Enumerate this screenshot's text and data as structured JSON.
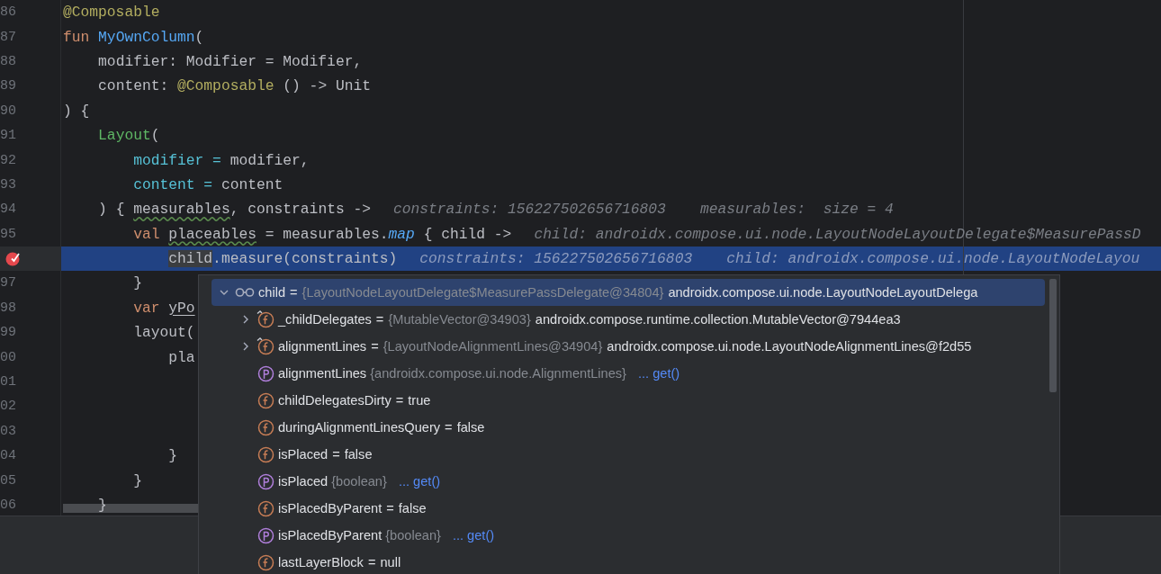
{
  "editor": {
    "lines": [
      {
        "number": "86",
        "current": false,
        "breakpoint": false,
        "tokens": [
          {
            "text": "@Composable",
            "kind": "annotation"
          }
        ]
      },
      {
        "number": "87",
        "current": false,
        "breakpoint": false,
        "tokens": [
          {
            "text": "fun ",
            "kind": "keyword"
          },
          {
            "text": "MyOwnColumn",
            "kind": "function"
          },
          {
            "text": "(",
            "kind": "plain"
          }
        ]
      },
      {
        "number": "88",
        "current": false,
        "breakpoint": false,
        "tokens": [
          {
            "text": "    modifier: Modifier = Modifier,",
            "kind": "plain"
          }
        ]
      },
      {
        "number": "89",
        "current": false,
        "breakpoint": false,
        "tokens": [
          {
            "text": "    content: ",
            "kind": "plain"
          },
          {
            "text": "@Composable",
            "kind": "annotation"
          },
          {
            "text": " () -> Unit",
            "kind": "plain"
          }
        ]
      },
      {
        "number": "90",
        "current": false,
        "breakpoint": false,
        "tokens": [
          {
            "text": ") {",
            "kind": "plain"
          }
        ]
      },
      {
        "number": "91",
        "current": false,
        "breakpoint": false,
        "tokens": [
          {
            "text": "    Layout",
            "kind": "call"
          },
          {
            "text": "(",
            "kind": "plain"
          }
        ]
      },
      {
        "number": "92",
        "current": false,
        "breakpoint": false,
        "tokens": [
          {
            "text": "        modifier =",
            "kind": "named-arg"
          },
          {
            "text": " modifier,",
            "kind": "plain"
          }
        ]
      },
      {
        "number": "93",
        "current": false,
        "breakpoint": false,
        "tokens": [
          {
            "text": "        content =",
            "kind": "named-arg"
          },
          {
            "text": " content",
            "kind": "plain"
          }
        ]
      },
      {
        "number": "94",
        "current": false,
        "breakpoint": false,
        "tokens": [
          {
            "text": "    ) { ",
            "kind": "plain"
          },
          {
            "text": "measurables",
            "kind": "warned"
          },
          {
            "text": ", constraints ->",
            "kind": "plain"
          }
        ],
        "hints": [
          "constraints: 156227502656716803",
          "measurables:  size = 4"
        ]
      },
      {
        "number": "95",
        "current": false,
        "breakpoint": false,
        "tokens": [
          {
            "text": "        val ",
            "kind": "keyword"
          },
          {
            "text": "placeables",
            "kind": "warned"
          },
          {
            "text": " = measurables.",
            "kind": "plain"
          },
          {
            "text": "map",
            "kind": "extension"
          },
          {
            "text": " { child ->",
            "kind": "plain"
          }
        ],
        "hints": [
          "child: androidx.compose.ui.node.LayoutNodeLayoutDelegate$MeasurePassD"
        ]
      },
      {
        "current": true,
        "breakpoint": true,
        "tokens": [
          {
            "text": "            child",
            "kind": "highlighted"
          },
          {
            "text": ".measure(constraints)",
            "kind": "plain"
          }
        ],
        "hints": [
          "constraints: 156227502656716803",
          "child: androidx.compose.ui.node.LayoutNodeLayou"
        ]
      },
      {
        "number": "97",
        "current": false,
        "breakpoint": false,
        "tokens": [
          {
            "text": "        }",
            "kind": "plain"
          }
        ]
      },
      {
        "number": "98",
        "current": false,
        "breakpoint": false,
        "tokens": [
          {
            "text": "        var ",
            "kind": "keyword"
          },
          {
            "text": "yPo",
            "kind": "mutable"
          }
        ]
      },
      {
        "number": "99",
        "current": false,
        "breakpoint": false,
        "tokens": [
          {
            "text": "        layout(",
            "kind": "plain"
          }
        ]
      },
      {
        "number": "00",
        "current": false,
        "breakpoint": false,
        "tokens": [
          {
            "text": "            pla",
            "kind": "plain"
          }
        ]
      },
      {
        "number": "01",
        "current": false,
        "breakpoint": false
      },
      {
        "number": "02",
        "current": false,
        "breakpoint": false
      },
      {
        "number": "03",
        "current": false,
        "breakpoint": false
      },
      {
        "number": "04",
        "current": false,
        "breakpoint": false,
        "tokens": [
          {
            "text": "            }",
            "kind": "plain"
          }
        ]
      },
      {
        "number": "05",
        "current": false,
        "breakpoint": false,
        "tokens": [
          {
            "text": "        }",
            "kind": "plain"
          }
        ]
      },
      {
        "number": "06",
        "current": false,
        "breakpoint": false,
        "tokens": [
          {
            "text": "    }",
            "kind": "plain"
          }
        ]
      }
    ]
  },
  "debug_popup": {
    "tree": [
      {
        "kind": "watch",
        "name": "child",
        "operator": "=",
        "type": "{LayoutNodeLayoutDelegate$MeasurePassDelegate@34804}",
        "value": "androidx.compose.ui.node.LayoutNodeLayoutDelega",
        "selected": true,
        "expanded": true,
        "children": [
          {
            "kind": "field",
            "linked": true,
            "name": "_childDelegates",
            "operator": "=",
            "type": "{MutableVector@34903}",
            "value": "androidx.compose.runtime.collection.MutableVector@7944ea3",
            "selected": false,
            "expanded": false
          },
          {
            "kind": "field",
            "linked": true,
            "name": "alignmentLines",
            "operator": "=",
            "type": "{LayoutNodeAlignmentLines@34904}",
            "value": "androidx.compose.ui.node.LayoutNodeAlignmentLines@f2d55",
            "selected": false,
            "expanded": false
          },
          {
            "kind": "property",
            "linked": false,
            "name": "alignmentLines",
            "type": "{androidx.compose.ui.node.AlignmentLines}",
            "action": "... get()",
            "selected": false
          },
          {
            "kind": "field",
            "linked": false,
            "name": "childDelegatesDirty",
            "operator": "=",
            "value": "true",
            "selected": false
          },
          {
            "kind": "field",
            "linked": false,
            "name": "duringAlignmentLinesQuery",
            "operator": "=",
            "value": "false",
            "selected": false
          },
          {
            "kind": "field",
            "linked": false,
            "name": "isPlaced",
            "operator": "=",
            "value": "false",
            "selected": false
          },
          {
            "kind": "property",
            "linked": false,
            "name": "isPlaced",
            "type": "{boolean}",
            "action": "... get()",
            "selected": false
          },
          {
            "kind": "field",
            "linked": false,
            "name": "isPlacedByParent",
            "operator": "=",
            "value": "false",
            "selected": false
          },
          {
            "kind": "property",
            "linked": false,
            "name": "isPlacedByParent",
            "type": "{boolean}",
            "action": "... get()",
            "selected": false
          },
          {
            "kind": "field",
            "linked": false,
            "name": "lastLayerBlock",
            "operator": "=",
            "value": "null",
            "selected": false
          }
        ]
      }
    ]
  }
}
